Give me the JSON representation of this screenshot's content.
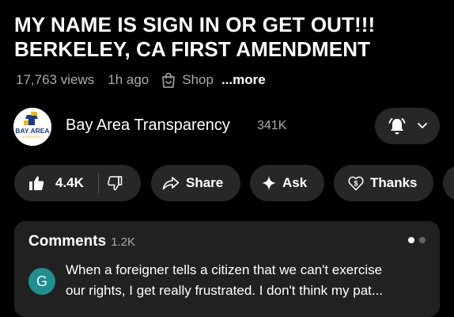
{
  "video": {
    "title_line1": "MY NAME IS SIGN IN OR GET OUT!!!",
    "title_line2": "BERKELEY, CA FIRST AMENDMENT",
    "views": "17,763 views",
    "time_ago": "1h ago",
    "shop_label": "Shop",
    "more_label": "...more"
  },
  "channel": {
    "name": "Bay Area Transparency",
    "subscribers": "341K",
    "avatar_text": "BAY AREA",
    "avatar_subtext": "TRANSPARENCY"
  },
  "actions": {
    "like_count": "4.4K",
    "share_label": "Share",
    "ask_label": "Ask",
    "thanks_label": "Thanks"
  },
  "comments": {
    "title": "Comments",
    "count": "1.2K",
    "top_comment": {
      "avatar_letter": "G",
      "line1": "When a foreigner tells a citizen that we can't exercise",
      "line2": "our rights, I get really frustrated.  I don't think my pat..."
    }
  },
  "colors": {
    "background": "#000000",
    "pill": "#272727",
    "card": "#212121",
    "muted_text": "#aaaaaa",
    "avatar_teal": "#1f8f8f",
    "logo_blue": "#1a3a8f",
    "logo_gold": "#f2b600"
  },
  "icons": [
    "shopping-bag-icon",
    "bell-icon",
    "chevron-down-icon",
    "thumbs-up-icon",
    "thumbs-down-icon",
    "share-icon",
    "sparkle-icon",
    "thanks-icon"
  ]
}
